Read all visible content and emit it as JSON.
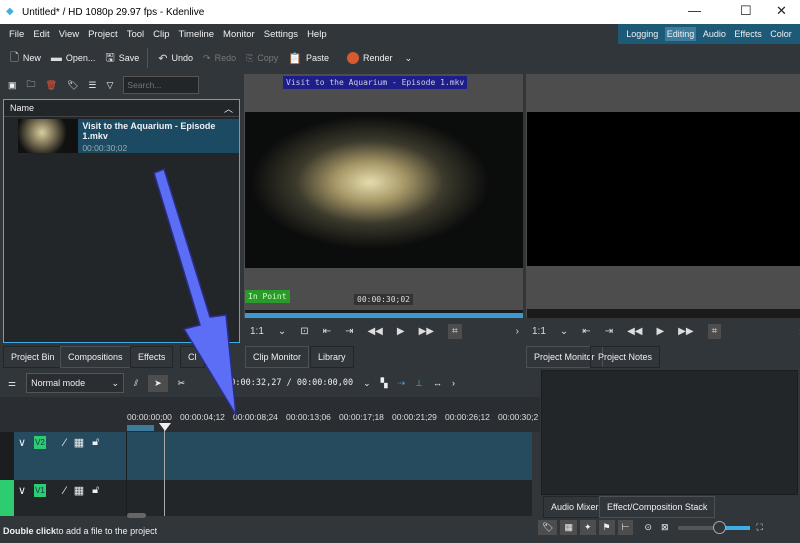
{
  "window": {
    "title": "Untitled* / HD 1080p 29.97 fps - Kdenlive",
    "min": "—",
    "max": "☐",
    "close": "✕"
  },
  "menu": [
    "File",
    "Edit",
    "View",
    "Project",
    "Tool",
    "Clip",
    "Timeline",
    "Monitor",
    "Settings",
    "Help"
  ],
  "workspaces": [
    "Logging",
    "Editing",
    "Audio",
    "Effects",
    "Color"
  ],
  "toolbar": {
    "new": "New",
    "open": "Open...",
    "save": "Save",
    "undo": "Undo",
    "redo": "Redo",
    "copy": "Copy",
    "paste": "Paste",
    "render": "Render"
  },
  "bin": {
    "search_placeholder": "Search...",
    "column": "Name",
    "clip": {
      "name": "Visit to the Aquarium - Episode 1.mkv",
      "duration": "00:00:30;02"
    }
  },
  "clip_monitor": {
    "overlay_title": "Visit to the Aquarium - Episode 1.mkv",
    "in_point": "In Point",
    "timecode": "00:00:30;02",
    "zoom": "1:1"
  },
  "project_monitor": {
    "zoom": "1:1"
  },
  "left_tabs": [
    "Project Bin",
    "Compositions",
    "Effects",
    "Cl"
  ],
  "monitor_tabs": [
    "Clip Monitor",
    "Library"
  ],
  "right_tabs": [
    "Project Monitor",
    "Project Notes"
  ],
  "timeline": {
    "mode": "Normal mode",
    "timecode": "00:00:32,27 / 00:00:00,00",
    "ruler": [
      "00:00:00;00",
      "00:00:04;12",
      "00:00:08;24",
      "00:00:13;06",
      "00:00:17;18",
      "00:00:21;29",
      "00:00:26;12",
      "00:00:30;2"
    ],
    "tracks": [
      "V2",
      "V1"
    ]
  },
  "bottom_tabs": [
    "Audio Mixer",
    "Effect/Composition Stack"
  ],
  "status": {
    "bold": "Double click",
    "rest": " to add a file to the project"
  },
  "colors": {
    "accent": "#3daee9",
    "workspace": "#1d5a78",
    "track_label": "#2ecc71",
    "arrow": "#5b6ef5"
  }
}
